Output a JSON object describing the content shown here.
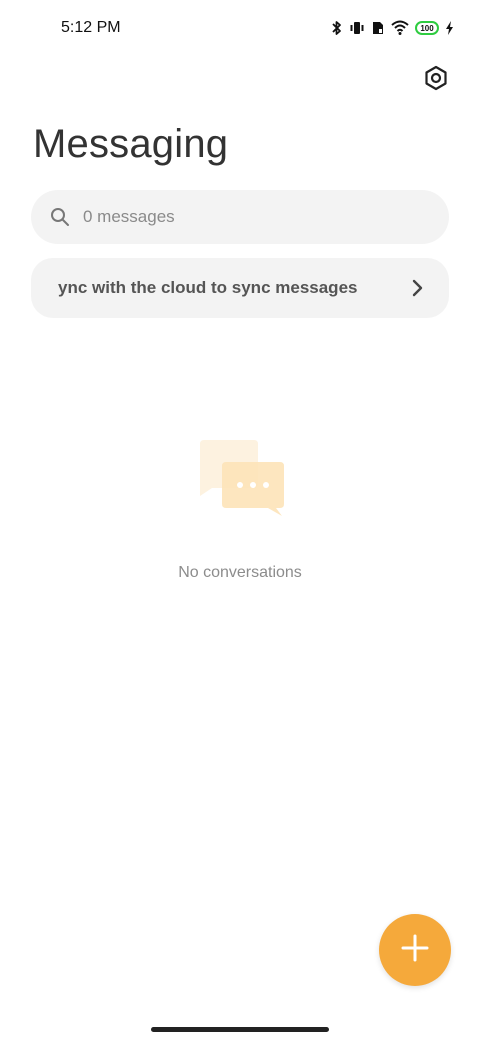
{
  "status_bar": {
    "time": "5:12 PM",
    "battery_level": "100",
    "icons": [
      "bluetooth-icon",
      "vibrate-icon",
      "sim-icon",
      "wifi-icon",
      "battery-icon",
      "charging-icon"
    ]
  },
  "header": {
    "title": "Messaging",
    "settings_icon": "settings-hexagon-icon"
  },
  "search": {
    "placeholder": "0 messages",
    "icon": "search-icon"
  },
  "sync_banner": {
    "text": "ync with the cloud to sync messages",
    "icon": "chevron-right-icon"
  },
  "empty_state": {
    "illustration": "chat-bubbles-icon",
    "text": "No conversations"
  },
  "fab": {
    "icon": "plus-icon",
    "color": "#f5a93b"
  },
  "colors": {
    "accent": "#f5a93b",
    "surface": "#f3f3f3",
    "battery_outline": "#2ecc40"
  }
}
